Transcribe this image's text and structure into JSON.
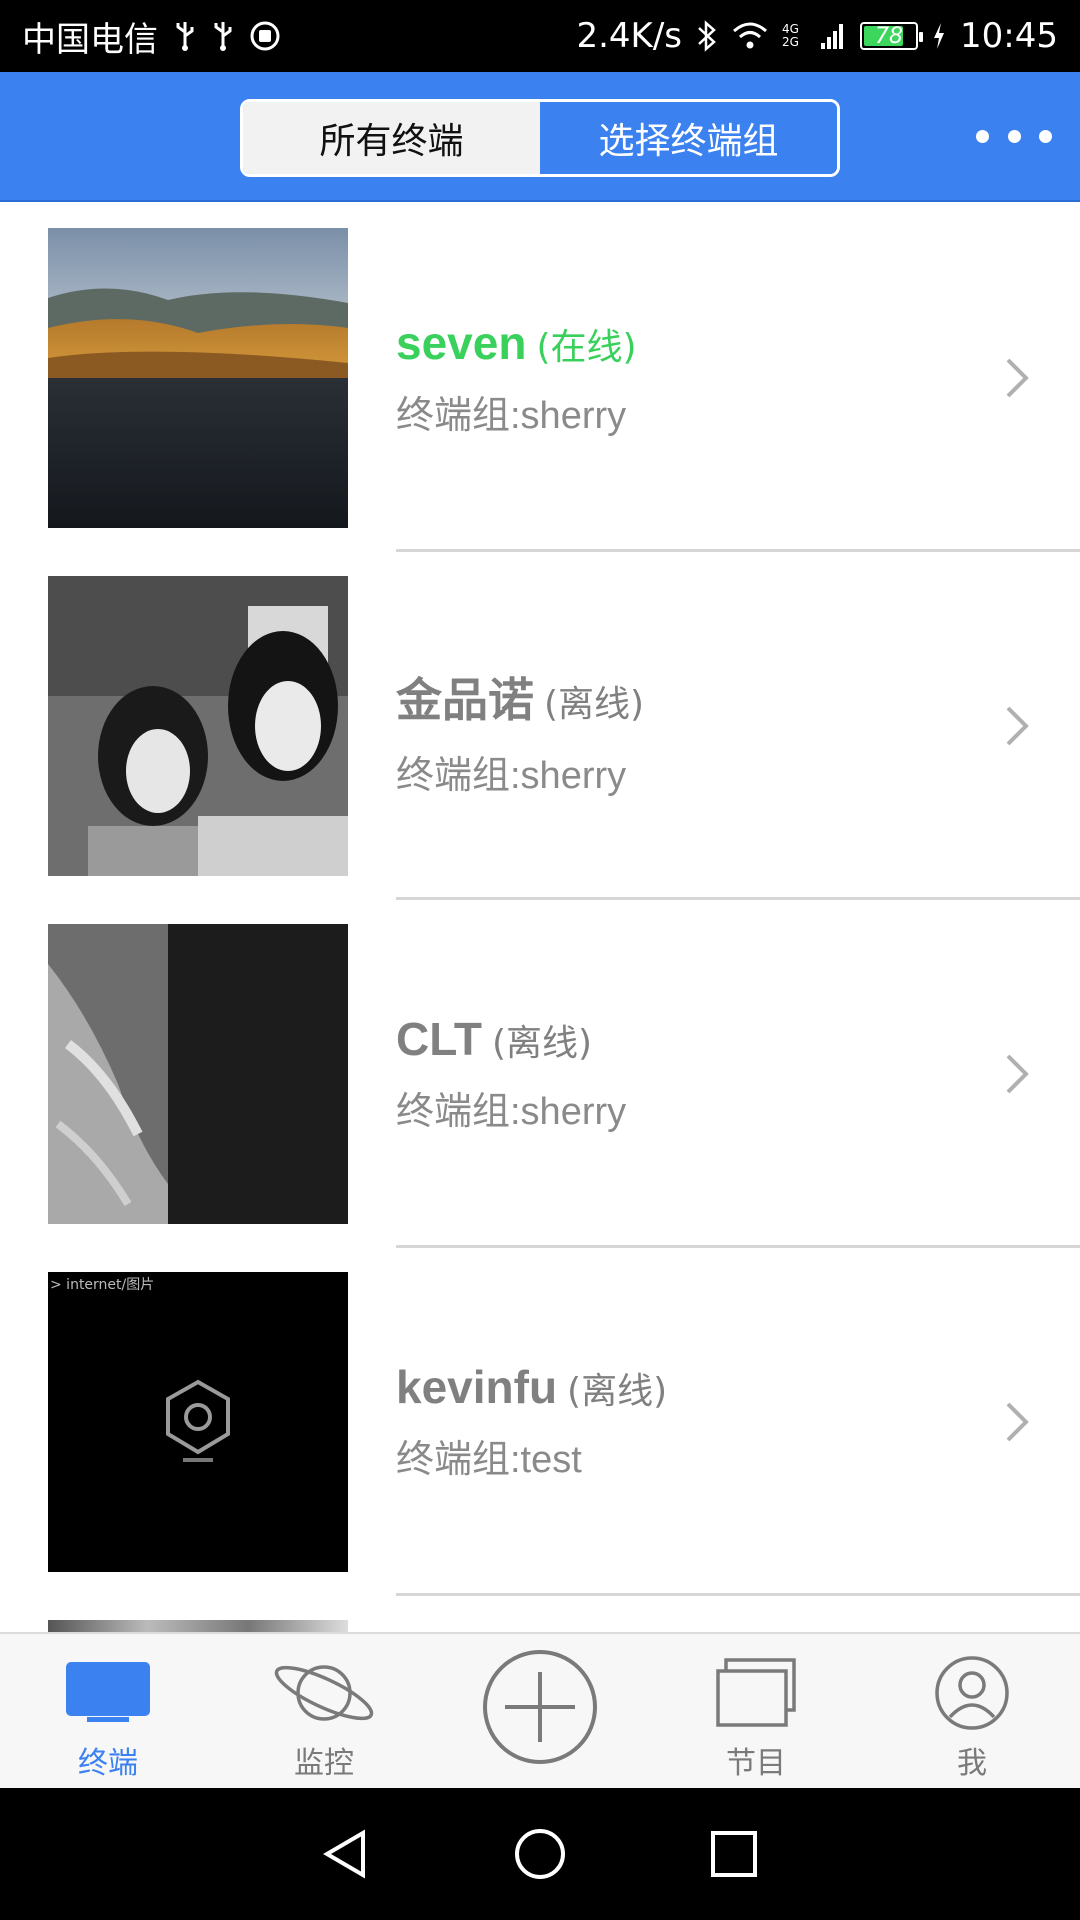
{
  "status_bar": {
    "carrier": "中国电信",
    "speed": "2.4K/s",
    "network": "4G 2G",
    "battery": "78",
    "battery_level": 0.78,
    "time": "10:45",
    "icons": [
      "usb-icon",
      "usb-icon",
      "app-icon",
      "bluetooth-icon",
      "wifi-icon",
      "signal-icon",
      "battery-icon",
      "charging-icon"
    ]
  },
  "header": {
    "tabs": [
      {
        "label": "所有终端",
        "active": false
      },
      {
        "label": "选择终端组",
        "active": true
      }
    ],
    "more_icon": "more-dots-icon",
    "bg_color": "#3b81f0"
  },
  "terminals": [
    {
      "name": "seven",
      "status": "(在线)",
      "group": "终端组:sherry",
      "online": true,
      "thumb": "landscape"
    },
    {
      "name": "金品诺",
      "status": "(离线)",
      "group": "终端组:sherry",
      "online": false,
      "thumb": "portrait"
    },
    {
      "name": "CLT",
      "status": "(离线)",
      "group": "终端组:sherry",
      "online": false,
      "thumb": "dark-split"
    },
    {
      "name": "kevinfu",
      "status": "(离线)",
      "group": "终端组:test",
      "online": false,
      "thumb": "black-logo",
      "thumb_caption": "> internet/图片"
    }
  ],
  "colors": {
    "online": "#39d05c",
    "offline": "#808080",
    "accent": "#3b81f0"
  },
  "bottom_nav": [
    {
      "label": "终端",
      "icon": "monitor-icon",
      "active": true
    },
    {
      "label": "监控",
      "icon": "planet-icon",
      "active": false
    },
    {
      "label": "",
      "icon": "plus-circle-icon",
      "active": false
    },
    {
      "label": "节目",
      "icon": "stacked-screens-icon",
      "active": false
    },
    {
      "label": "我",
      "icon": "user-icon",
      "active": false
    }
  ],
  "system_nav": [
    "back-icon",
    "home-icon",
    "recents-icon"
  ]
}
